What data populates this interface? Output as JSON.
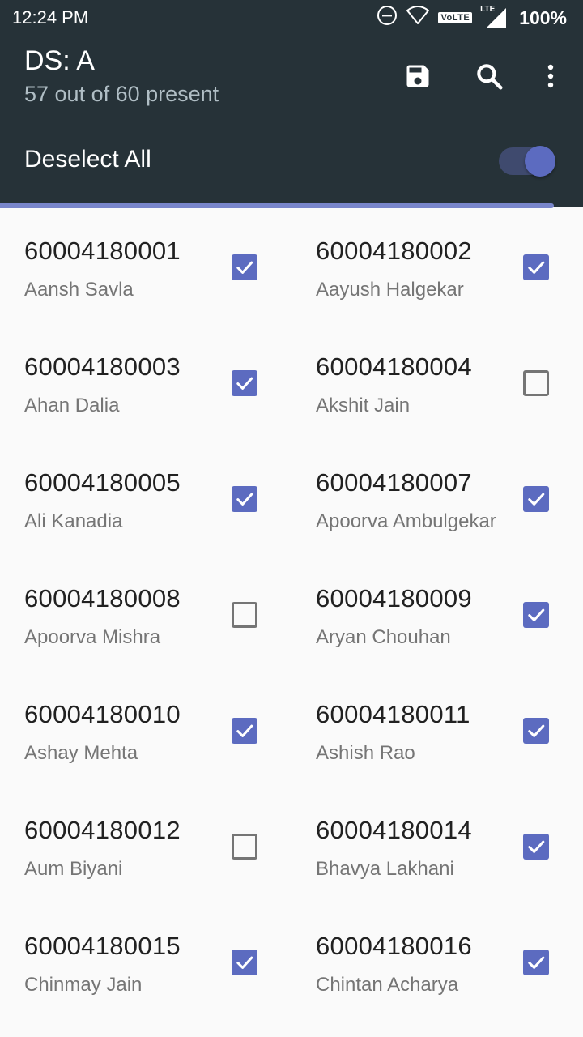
{
  "status_bar": {
    "time": "12:24 PM",
    "volte": "VoLTE",
    "lte": "LTE",
    "battery": "100%"
  },
  "header": {
    "title": "DS: A",
    "subtitle": "57 out of 60 present",
    "deselect_label": "Deselect All",
    "toggle_on": true
  },
  "colors": {
    "app_bar": "#263238",
    "accent": "#5c6bc0",
    "progress": "#7986cb"
  },
  "students": [
    {
      "id": "60004180001",
      "name": "Aansh Savla",
      "present": true
    },
    {
      "id": "60004180002",
      "name": "Aayush Halgekar",
      "present": true
    },
    {
      "id": "60004180003",
      "name": "Ahan Dalia",
      "present": true
    },
    {
      "id": "60004180004",
      "name": "Akshit Jain",
      "present": false
    },
    {
      "id": "60004180005",
      "name": "Ali Kanadia",
      "present": true
    },
    {
      "id": "60004180007",
      "name": "Apoorva Ambulgekar",
      "present": true
    },
    {
      "id": "60004180008",
      "name": "Apoorva Mishra",
      "present": false
    },
    {
      "id": "60004180009",
      "name": "Aryan Chouhan",
      "present": true
    },
    {
      "id": "60004180010",
      "name": "Ashay Mehta",
      "present": true
    },
    {
      "id": "60004180011",
      "name": "Ashish Rao",
      "present": true
    },
    {
      "id": "60004180012",
      "name": "Aum Biyani",
      "present": false
    },
    {
      "id": "60004180014",
      "name": "Bhavya Lakhani",
      "present": true
    },
    {
      "id": "60004180015",
      "name": "Chinmay Jain",
      "present": true
    },
    {
      "id": "60004180016",
      "name": "Chintan Acharya",
      "present": true
    }
  ]
}
